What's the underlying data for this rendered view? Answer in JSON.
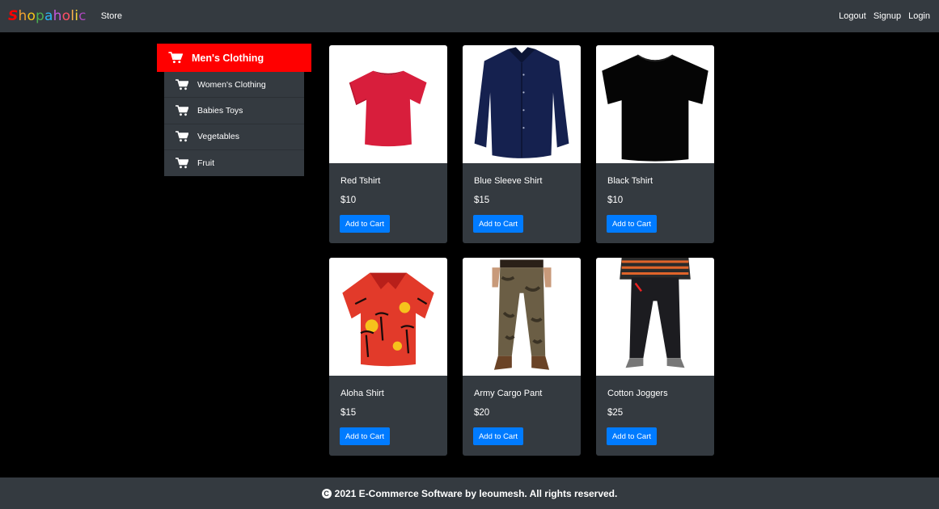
{
  "nav": {
    "brand_letters": [
      {
        "ch": "S",
        "color": "#ff0000"
      },
      {
        "ch": "h",
        "color": "#f0a030"
      },
      {
        "ch": "o",
        "color": "#f5c518"
      },
      {
        "ch": "p",
        "color": "#4caf50"
      },
      {
        "ch": "a",
        "color": "#29b6f6"
      },
      {
        "ch": "h",
        "color": "#c158dc"
      },
      {
        "ch": "o",
        "color": "#ff4f64"
      },
      {
        "ch": "l",
        "color": "#ffb74d"
      },
      {
        "ch": "i",
        "color": "#fdd835"
      },
      {
        "ch": "c",
        "color": "#ab47bc"
      }
    ],
    "store": "Store",
    "logout": "Logout",
    "signup": "Signup",
    "login": "Login"
  },
  "sidebar": {
    "active": "Men's Clothing",
    "items": [
      "Women's Clothing",
      "Babies Toys",
      "Vegetables",
      "Fruit"
    ]
  },
  "products": [
    {
      "name": "Red Tshirt",
      "price": "$10",
      "button": "Add to Cart",
      "image": "red-tshirt"
    },
    {
      "name": "Blue Sleeve Shirt",
      "price": "$15",
      "button": "Add to Cart",
      "image": "blue-shirt"
    },
    {
      "name": "Black Tshirt",
      "price": "$10",
      "button": "Add to Cart",
      "image": "black-tshirt"
    },
    {
      "name": "Aloha Shirt",
      "price": "$15",
      "button": "Add to Cart",
      "image": "aloha-shirt"
    },
    {
      "name": "Army Cargo Pant",
      "price": "$20",
      "button": "Add to Cart",
      "image": "cargo-pant"
    },
    {
      "name": "Cotton Joggers",
      "price": "$25",
      "button": "Add to Cart",
      "image": "joggers"
    }
  ],
  "footer": {
    "text": "2021 E-Commerce Software by leoumesh. All rights reserved."
  },
  "colors": {
    "navbar": "#343a40",
    "active_category": "#ff0000",
    "button": "#007bff"
  }
}
